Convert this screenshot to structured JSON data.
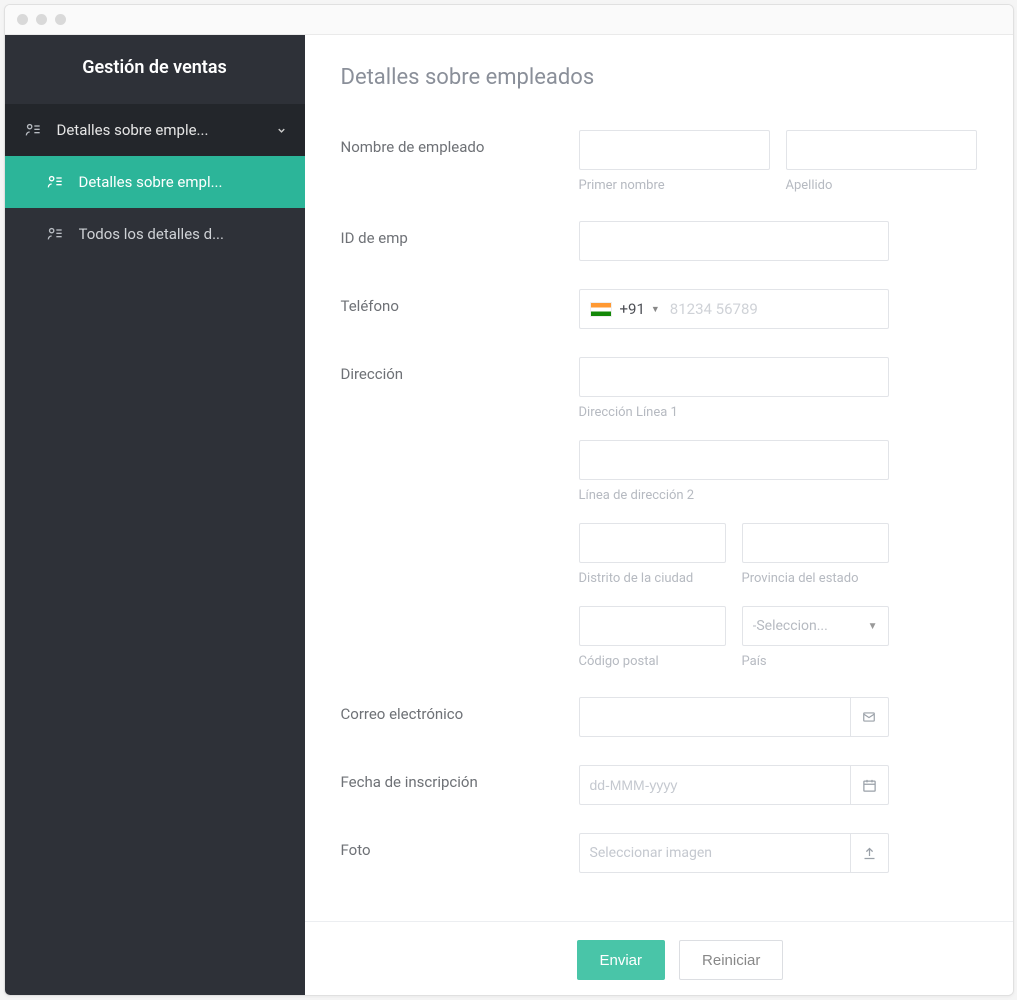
{
  "sidebar": {
    "title": "Gestión de ventas",
    "group_label": "Detalles sobre emple...",
    "items": [
      {
        "label": "Detalles sobre empl...",
        "active": true
      },
      {
        "label": "Todos los detalles d...",
        "active": false
      }
    ]
  },
  "page": {
    "title": "Detalles sobre empleados"
  },
  "form": {
    "employee_name": {
      "label": "Nombre de empleado",
      "first_sublabel": "Primer nombre",
      "last_sublabel": "Apellido"
    },
    "emp_id": {
      "label": "ID de emp"
    },
    "phone": {
      "label": "Teléfono",
      "country_code": "+91",
      "placeholder": "81234 56789"
    },
    "address": {
      "label": "Dirección",
      "line1_sublabel": "Dirección Línea 1",
      "line2_sublabel": "Línea de dirección 2",
      "city_sublabel": "Distrito de la ciudad",
      "state_sublabel": "Provincia del estado",
      "postal_sublabel": "Código postal",
      "country_sublabel": "País",
      "country_select_placeholder": "-Seleccion..."
    },
    "email": {
      "label": "Correo electrónico"
    },
    "date": {
      "label": "Fecha de inscripción",
      "placeholder": "dd-MMM-yyyy"
    },
    "photo": {
      "label": "Foto",
      "placeholder": "Seleccionar imagen"
    }
  },
  "buttons": {
    "submit": "Enviar",
    "reset": "Reiniciar"
  }
}
